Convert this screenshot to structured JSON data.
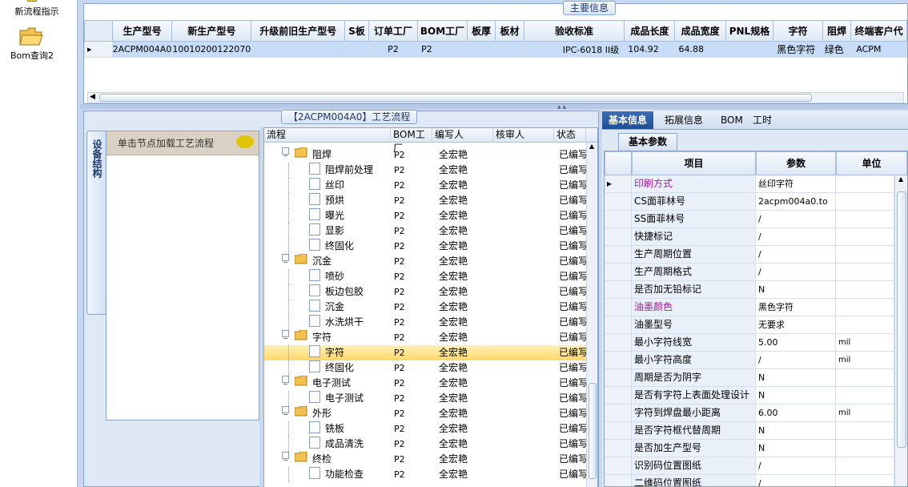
{
  "left_nav": {
    "items": [
      {
        "label": "新流程指示",
        "icon": "flow-icon"
      },
      {
        "label": "Bom查询2",
        "icon": "folder-open-icon"
      }
    ]
  },
  "main_info": {
    "caption": "主要信息",
    "columns": [
      "生产型号",
      "新生产型号",
      "升级前旧生产型号",
      "S板",
      "订单工厂",
      "BOM工厂",
      "板厚",
      "板材",
      "验收标准",
      "成品长度",
      "成品宽度",
      "PNL规格",
      "字符",
      "阻焊",
      "终端客户代"
    ],
    "rows": [
      [
        "2ACPM004A0",
        "10010200122070",
        "",
        "",
        "P2",
        "P2",
        "",
        "",
        "IPC-6018 II级",
        "104.92",
        "64.88",
        "",
        "黑色字符",
        "绿色",
        "ACPM"
      ]
    ]
  },
  "process": {
    "caption": "【2ACPM004A0】工艺流程",
    "side_tab_label": "设备结构",
    "hint": "单击节点加载工艺流程",
    "tree_columns": [
      "流程",
      "BOM工厂",
      "编写人",
      "核审人",
      "状态"
    ],
    "tree_rows": [
      {
        "level": 1,
        "name": "阻焊",
        "bom": "P2",
        "writer": "全宏艳",
        "reviewer": "",
        "status": "已编写"
      },
      {
        "level": 2,
        "name": "阻焊前处理",
        "bom": "P2",
        "writer": "全宏艳",
        "reviewer": "",
        "status": "已编写"
      },
      {
        "level": 2,
        "name": "丝印",
        "bom": "P2",
        "writer": "全宏艳",
        "reviewer": "",
        "status": "已编写"
      },
      {
        "level": 2,
        "name": "预烘",
        "bom": "P2",
        "writer": "全宏艳",
        "reviewer": "",
        "status": "已编写"
      },
      {
        "level": 2,
        "name": "曝光",
        "bom": "P2",
        "writer": "全宏艳",
        "reviewer": "",
        "status": "已编写"
      },
      {
        "level": 2,
        "name": "显影",
        "bom": "P2",
        "writer": "全宏艳",
        "reviewer": "",
        "status": "已编写"
      },
      {
        "level": 2,
        "name": "终固化",
        "bom": "P2",
        "writer": "全宏艳",
        "reviewer": "",
        "status": "已编写"
      },
      {
        "level": 1,
        "name": "沉金",
        "bom": "P2",
        "writer": "全宏艳",
        "reviewer": "",
        "status": "已编写"
      },
      {
        "level": 2,
        "name": "喷砂",
        "bom": "P2",
        "writer": "全宏艳",
        "reviewer": "",
        "status": "已编写"
      },
      {
        "level": 2,
        "name": "板边包胶",
        "bom": "P2",
        "writer": "全宏艳",
        "reviewer": "",
        "status": "已编写"
      },
      {
        "level": 2,
        "name": "沉金",
        "bom": "P2",
        "writer": "全宏艳",
        "reviewer": "",
        "status": "已编写"
      },
      {
        "level": 2,
        "name": "水洗烘干",
        "bom": "P2",
        "writer": "全宏艳",
        "reviewer": "",
        "status": "已编写"
      },
      {
        "level": 1,
        "name": "字符",
        "bom": "P2",
        "writer": "全宏艳",
        "reviewer": "",
        "status": "已编写"
      },
      {
        "level": 2,
        "name": "字符",
        "bom": "P2",
        "writer": "全宏艳",
        "reviewer": "",
        "status": "已编写",
        "selected": true
      },
      {
        "level": 2,
        "name": "终固化",
        "bom": "P2",
        "writer": "全宏艳",
        "reviewer": "",
        "status": "已编写"
      },
      {
        "level": 1,
        "name": "电子测试",
        "bom": "P2",
        "writer": "全宏艳",
        "reviewer": "",
        "status": "已编写"
      },
      {
        "level": 2,
        "name": "电子测试",
        "bom": "P2",
        "writer": "全宏艳",
        "reviewer": "",
        "status": "已编写"
      },
      {
        "level": 1,
        "name": "外形",
        "bom": "P2",
        "writer": "全宏艳",
        "reviewer": "",
        "status": "已编写"
      },
      {
        "level": 2,
        "name": "铣板",
        "bom": "P2",
        "writer": "全宏艳",
        "reviewer": "",
        "status": "已编写"
      },
      {
        "level": 2,
        "name": "成品清洗",
        "bom": "P2",
        "writer": "全宏艳",
        "reviewer": "",
        "status": "已编写"
      },
      {
        "level": 1,
        "name": "终检",
        "bom": "P2",
        "writer": "全宏艳",
        "reviewer": "",
        "status": "已编写"
      },
      {
        "level": 2,
        "name": "功能检查",
        "bom": "P2",
        "writer": "全宏艳",
        "reviewer": "",
        "status": "已编写"
      }
    ]
  },
  "right": {
    "tabs": [
      "基本信息",
      "拓展信息",
      "BOM",
      "工时"
    ],
    "active_tab": 0,
    "subtab": "基本参数",
    "columns": [
      "项目",
      "参数",
      "单位"
    ],
    "rows": [
      {
        "item": "印刷方式",
        "value": "丝印字符",
        "unit": "",
        "highlight": true
      },
      {
        "item": "CS面菲林号",
        "value": "2acpm004a0.to",
        "unit": ""
      },
      {
        "item": "SS面菲林号",
        "value": "/",
        "unit": ""
      },
      {
        "item": "快捷标记",
        "value": "/",
        "unit": ""
      },
      {
        "item": "生产周期位置",
        "value": "/",
        "unit": ""
      },
      {
        "item": "生产周期格式",
        "value": "/",
        "unit": ""
      },
      {
        "item": "是否加无铅标记",
        "value": "N",
        "unit": ""
      },
      {
        "item": "油墨颜色",
        "value": "黑色字符",
        "unit": "",
        "highlight": true
      },
      {
        "item": "油墨型号",
        "value": "无要求",
        "unit": ""
      },
      {
        "item": "最小字符线宽",
        "value": "5.00",
        "unit": "mil"
      },
      {
        "item": "最小字符高度",
        "value": "/",
        "unit": "mil"
      },
      {
        "item": "周期是否为阴字",
        "value": "N",
        "unit": ""
      },
      {
        "item": "是否有字符上表面处理设计",
        "value": "N",
        "unit": ""
      },
      {
        "item": "字符到焊盘最小距离",
        "value": "6.00",
        "unit": "mil"
      },
      {
        "item": "是否字符框代替周期",
        "value": "N",
        "unit": ""
      },
      {
        "item": "是否加生产型号",
        "value": "N",
        "unit": ""
      },
      {
        "item": "识别码位置图纸",
        "value": "/",
        "unit": ""
      },
      {
        "item": "二维码位置图纸",
        "value": "/",
        "unit": ""
      }
    ]
  },
  "colors": {
    "accent": "#1e4d94",
    "highlight_text": "#a0209a",
    "selection": "#ffd86a"
  }
}
